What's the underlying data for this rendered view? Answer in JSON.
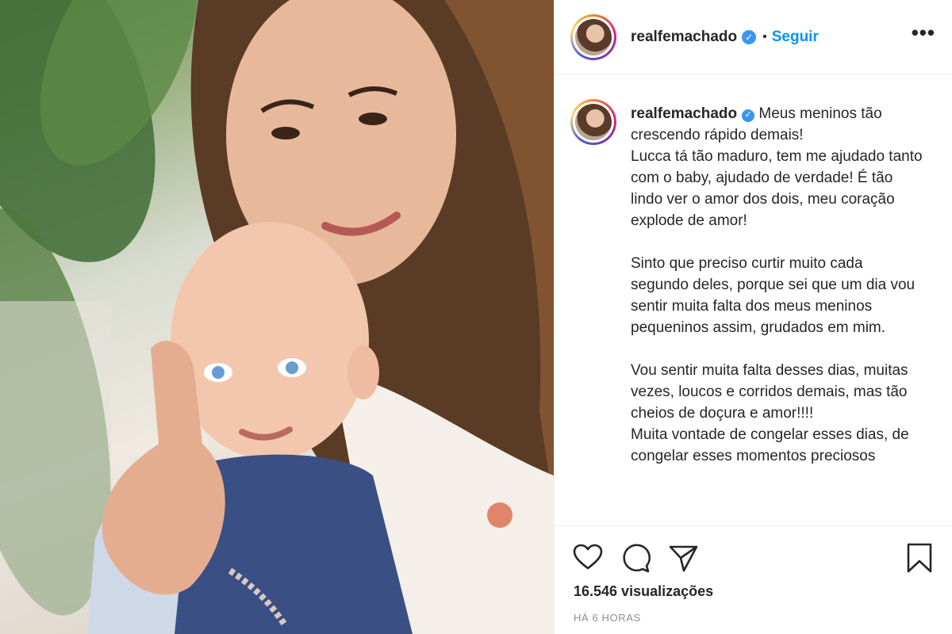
{
  "header": {
    "username": "realfemachado",
    "verified_glyph": "✓",
    "separator": "•",
    "follow_label": "Seguir",
    "more_label": "•••"
  },
  "caption": {
    "username": "realfemachado",
    "verified_glyph": "✓",
    "text": "Meus meninos tão crescendo rápido demais!\nLucca tá tão maduro, tem me ajudado tanto com o baby, ajudado de verdade! É tão lindo ver o amor dos dois, meu coração explode de amor!\n\nSinto que preciso curtir muito cada segundo deles, porque sei que um dia vou sentir muita falta dos meus meninos pequeninos assim, grudados em mim.\n\nVou sentir muita falta desses dias, muitas vezes, loucos e corridos demais, mas tão cheios de doçura e amor!!!!\nMuita vontade de congelar esses dias, de congelar esses momentos preciosos"
  },
  "actions": {
    "like_icon": "heart-icon",
    "comment_icon": "comment-icon",
    "share_icon": "share-icon",
    "save_icon": "bookmark-icon"
  },
  "stats": {
    "views": "16.546 visualizações",
    "timestamp": "HÁ 6 HORAS"
  },
  "colors": {
    "follow": "#0095f6",
    "verified": "#3897f0",
    "text": "#262626",
    "muted": "#8e8e8e"
  }
}
